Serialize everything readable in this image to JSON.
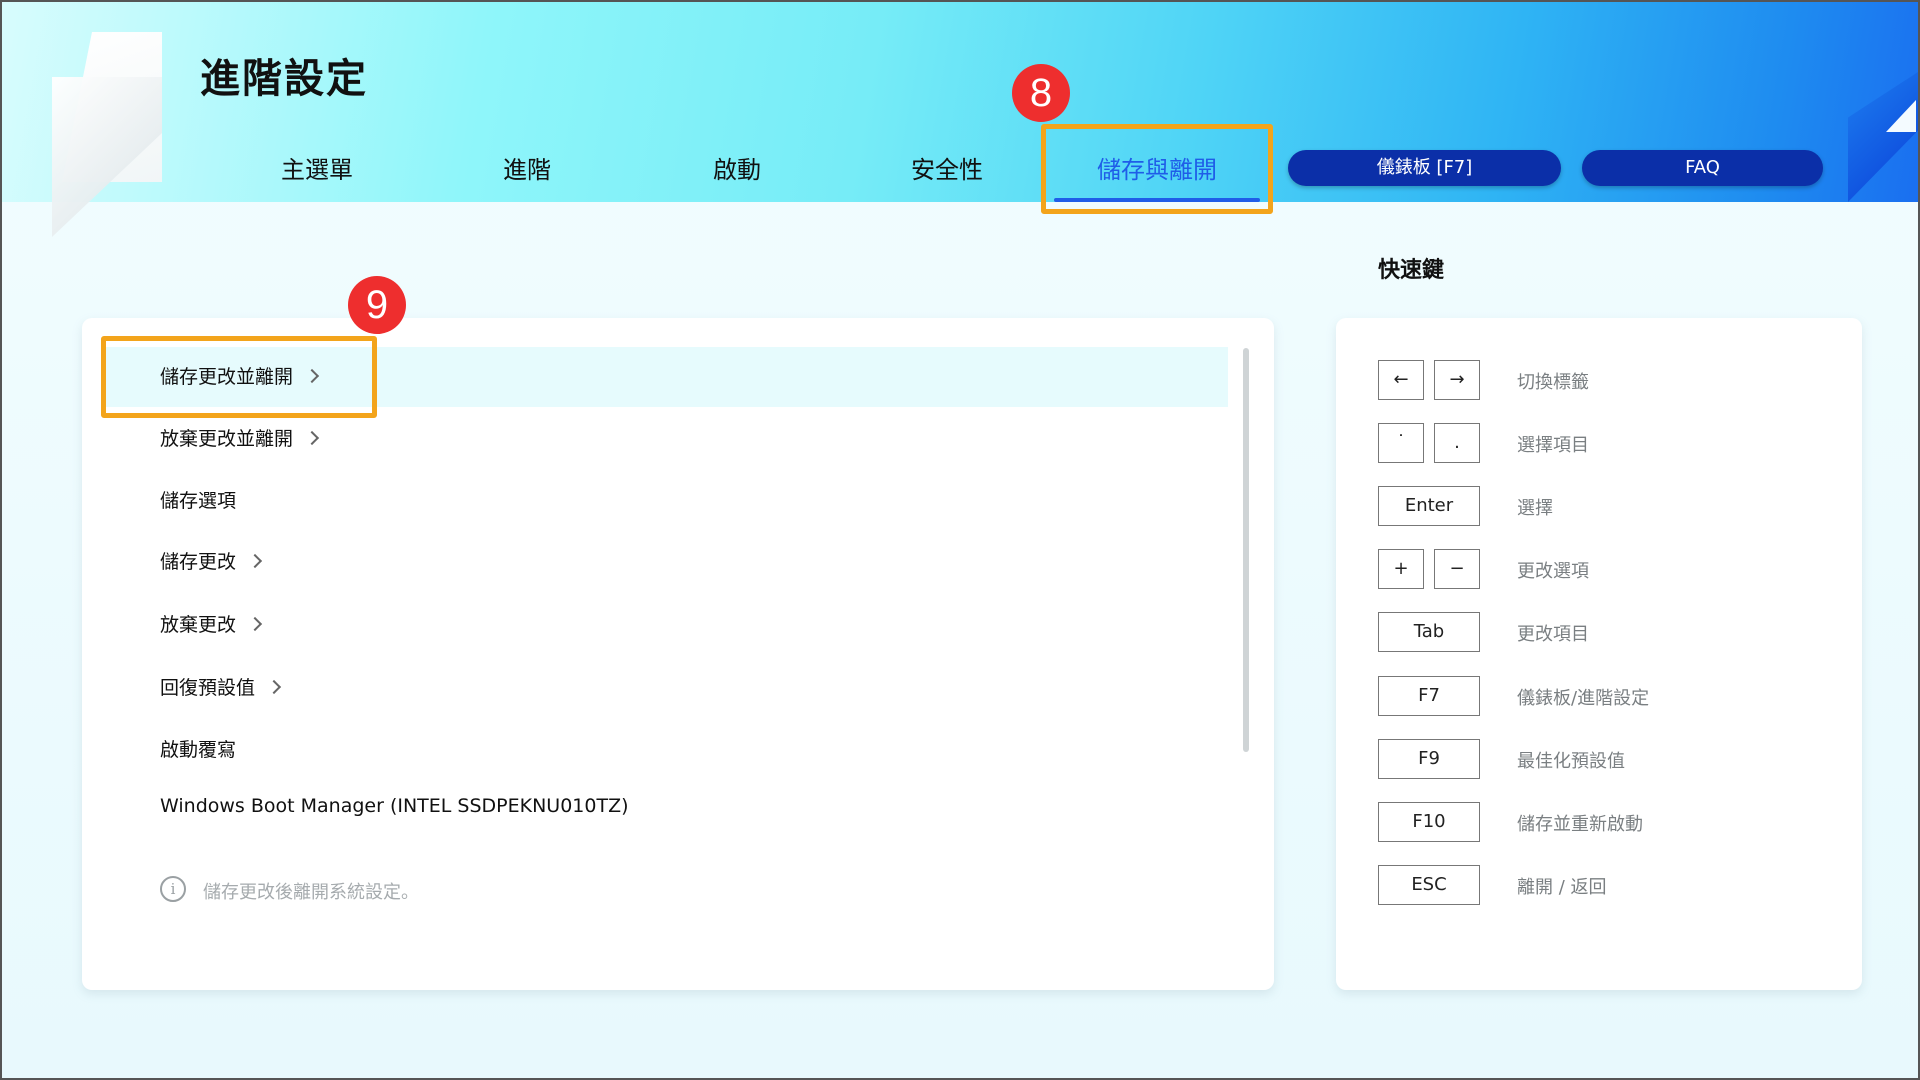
{
  "page": {
    "title": "進階設定"
  },
  "tabs": [
    {
      "label": "主選單",
      "active": false
    },
    {
      "label": "進階",
      "active": false
    },
    {
      "label": "啟動",
      "active": false
    },
    {
      "label": "安全性",
      "active": false
    },
    {
      "label": "儲存與離開",
      "active": true
    }
  ],
  "header_buttons": {
    "dashboard": "儀錶板 [F7]",
    "faq": "FAQ"
  },
  "markers": {
    "tab": "8",
    "menu": "9"
  },
  "menu": {
    "items": [
      {
        "label": "儲存更改並離開",
        "chevron": true,
        "selected": true
      },
      {
        "label": "放棄更改並離開",
        "chevron": true
      },
      {
        "label": "儲存選項",
        "chevron": false
      },
      {
        "label": "儲存更改",
        "chevron": true
      },
      {
        "label": "放棄更改",
        "chevron": true
      },
      {
        "label": "回復預設值",
        "chevron": true
      },
      {
        "label": "啟動覆寫",
        "chevron": false
      },
      {
        "label": "Windows Boot Manager (INTEL SSDPEKNU010TZ)",
        "chevron": false
      }
    ],
    "info_icon": "i",
    "info_text": "儲存更改後離開系統設定。"
  },
  "shortcuts": {
    "title": "快速鍵",
    "rows": [
      {
        "keys": [
          "←",
          "→"
        ],
        "desc": "切換標籤"
      },
      {
        "keys": [
          "˙",
          "."
        ],
        "desc": "選擇項目"
      },
      {
        "keys": [
          "Enter"
        ],
        "desc": "選擇"
      },
      {
        "keys": [
          "+",
          "−"
        ],
        "desc": "更改選項"
      },
      {
        "keys": [
          "Tab"
        ],
        "desc": "更改項目"
      },
      {
        "keys": [
          "F7"
        ],
        "desc": "儀錶板/進階設定"
      },
      {
        "keys": [
          "F9"
        ],
        "desc": "最佳化預設值"
      },
      {
        "keys": [
          "F10"
        ],
        "desc": "儲存並重新啟動"
      },
      {
        "keys": [
          "ESC"
        ],
        "desc": "離開 / 返回"
      }
    ]
  },
  "colors": {
    "accent": "#1f5de8",
    "pill": "#0b2fa8",
    "highlight": "#f3a41b",
    "marker": "#ee2e2e"
  }
}
